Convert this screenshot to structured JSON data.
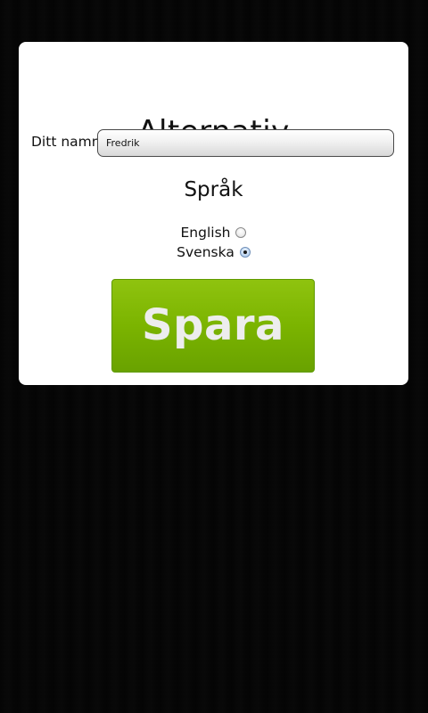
{
  "settings": {
    "title": "Alternativ",
    "name_label": "Ditt namn",
    "name_value": "Fredrik",
    "language_heading": "Språk",
    "languages": [
      {
        "label": "English",
        "selected": false
      },
      {
        "label": "Svenska",
        "selected": true
      }
    ],
    "save_label": "Spara"
  },
  "colors": {
    "panel_background": "#ffffff",
    "save_button": "#7bb400",
    "page_background": "#1c1c1c"
  }
}
